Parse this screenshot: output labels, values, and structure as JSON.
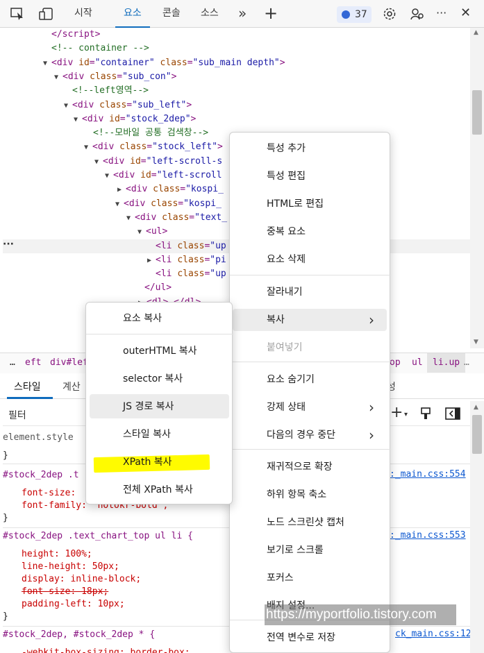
{
  "toolbar": {
    "tabs": [
      "시작",
      "요소",
      "콘솔",
      "소스"
    ],
    "more_tabs_icon": "»",
    "add_icon": "+",
    "issues_count": "37",
    "ellipsis": "···",
    "close": "✕"
  },
  "tree": {
    "lines": [
      {
        "html": "<span class='tag'>&lt;/script&gt;</span>"
      },
      {
        "html": "<span class='cmt'>&lt;!-- container --&gt;</span>"
      },
      {
        "html": "<span class='tri'>▼</span><span class='tag'>&lt;div </span><span class='attr'>id</span><span class='tag'>=</span><span class='val'>\"container\"</span> <span class='attr'>class</span><span class='tag'>=</span><span class='val'>\"sub_main depth\"</span><span class='tag'>&gt;</span>"
      },
      {
        "html": "<span class='tri'>▼</span><span class='tag'>&lt;div </span><span class='attr'>class</span><span class='tag'>=</span><span class='val'>\"sub_con\"</span><span class='tag'>&gt;</span>"
      },
      {
        "html": "<span class='cmt'>&lt;!--left영역--&gt;</span>"
      },
      {
        "html": "<span class='tri'>▼</span><span class='tag'>&lt;div </span><span class='attr'>class</span><span class='tag'>=</span><span class='val'>\"sub_left\"</span><span class='tag'>&gt;</span>"
      },
      {
        "html": "<span class='tri'>▼</span><span class='tag'>&lt;div </span><span class='attr'>id</span><span class='tag'>=</span><span class='val'>\"stock_2dep\"</span><span class='tag'>&gt;</span>"
      },
      {
        "html": "<span class='cmt'>&lt;!--모바일 공통 검색창--&gt;</span>"
      },
      {
        "html": "<span class='tri'>▼</span><span class='tag'>&lt;div </span><span class='attr'>class</span><span class='tag'>=</span><span class='val'>\"stock_left\"</span><span class='tag'>&gt;</span>"
      },
      {
        "html": "<span class='tri'>▼</span><span class='tag'>&lt;div </span><span class='attr'>id</span><span class='tag'>=</span><span class='val'>\"left-scroll-s</span>"
      },
      {
        "html": "<span class='tri'>▼</span><span class='tag'>&lt;div </span><span class='attr'>id</span><span class='tag'>=</span><span class='val'>\"left-scroll</span>"
      },
      {
        "html": "<span class='tri'>▶</span><span class='tag'>&lt;div </span><span class='attr'>class</span><span class='tag'>=</span><span class='val'>\"kospi_</span>"
      },
      {
        "html": "<span class='tri'>▼</span><span class='tag'>&lt;div </span><span class='attr'>class</span><span class='tag'>=</span><span class='val'>\"kospi_</span>"
      },
      {
        "html": "<span class='tri'>▼</span><span class='tag'>&lt;div </span><span class='attr'>class</span><span class='tag'>=</span><span class='val'>\"text_</span>"
      },
      {
        "html": "<span class='tri'>▼</span><span class='tag'>&lt;ul&gt;</span>"
      },
      {
        "html": "<span class='tag'>&lt;li </span><span class='attr'>class</span><span class='tag'>=</span><span class='val'>\"up</span>"
      },
      {
        "html": "<span class='tri'>▶</span><span class='tag'>&lt;li </span><span class='attr'>class</span><span class='tag'>=</span><span class='val'>\"pi</span>"
      },
      {
        "html": "<span class='tag'>&lt;li </span><span class='attr'>class</span><span class='tag'>=</span><span class='val'>\"up</span>"
      },
      {
        "html": "<span class='tag'>&lt;/ul&gt;</span>"
      },
      {
        "html": "<span class='tri'>▶</span><span class='tag'>&lt;dl&gt;…&lt;/dl&gt;</span>"
      }
    ],
    "gutter_dots": "···"
  },
  "breadcrumb": [
    "…",
    "eft",
    "div#left",
    "op",
    "ul",
    "li.up",
    "…"
  ],
  "styles_tabs": [
    "스타일",
    "계산",
    "성"
  ],
  "filter_placeholder": "필터",
  "styles": {
    "element_style": "element.style",
    "close_brace": "}",
    "rule1_selector": "#stock_2dep .t",
    "rule1_prop1": "font-size:",
    "rule1_prop2": "font-family: \"notokr-bold\";",
    "rule1_link": ":_main.css:554",
    "rule2_selector": "#stock_2dep .text_chart_top ul li {",
    "rule2_link": ":_main.css:553",
    "rule2_props": [
      "height: 100%;",
      "line-height: 50px;",
      "display: inline-block;",
      "font-size: 18px;",
      "padding-left: 10px;"
    ],
    "rule3_selector": "#stock_2dep, #stock_2dep * {",
    "rule3_link": "ck_main.css:12",
    "rule3_prop": "-webkit-box-sizing: border-box;"
  },
  "main_menu": {
    "items": [
      {
        "label": "특성 추가",
        "name": "menu-add-attribute"
      },
      {
        "label": "특성 편집",
        "name": "menu-edit-attribute"
      },
      {
        "label": "HTML로 편집",
        "name": "menu-edit-as-html"
      },
      {
        "label": "중복 요소",
        "name": "menu-duplicate-element"
      },
      {
        "label": "요소 삭제",
        "name": "menu-delete-element"
      },
      {
        "label": "잘라내기",
        "name": "menu-cut"
      },
      {
        "label": "복사",
        "name": "menu-copy"
      },
      {
        "label": "붙여넣기",
        "name": "menu-paste"
      },
      {
        "label": "요소 숨기기",
        "name": "menu-hide-element"
      },
      {
        "label": "강제 상태",
        "name": "menu-force-state"
      },
      {
        "label": "다음의 경우 중단",
        "name": "menu-break-on"
      },
      {
        "label": "재귀적으로 확장",
        "name": "menu-expand-recursively"
      },
      {
        "label": "하위 항목 축소",
        "name": "menu-collapse-children"
      },
      {
        "label": "노드 스크린샷 캡처",
        "name": "menu-capture-node-screenshot"
      },
      {
        "label": "보기로 스크롤",
        "name": "menu-scroll-into-view"
      },
      {
        "label": "포커스",
        "name": "menu-focus"
      },
      {
        "label": "배지 설정...",
        "name": "menu-badge-settings"
      },
      {
        "label": "전역 변수로 저장",
        "name": "menu-store-as-global-variable"
      }
    ]
  },
  "copy_submenu": {
    "items": [
      {
        "label": "요소 복사",
        "name": "submenu-copy-element"
      },
      {
        "label": "outerHTML 복사",
        "name": "submenu-copy-outerhtml"
      },
      {
        "label": "selector 복사",
        "name": "submenu-copy-selector"
      },
      {
        "label": "JS 경로 복사",
        "name": "submenu-copy-js-path"
      },
      {
        "label": "스타일 복사",
        "name": "submenu-copy-styles"
      },
      {
        "label": "XPath 복사",
        "name": "submenu-copy-xpath"
      },
      {
        "label": "전체 XPath 복사",
        "name": "submenu-copy-full-xpath"
      }
    ]
  },
  "colors": {
    "accent": "#0f6cbd",
    "highlight": "#fffb00"
  },
  "watermark": "https://myportfolio.tistory.com"
}
